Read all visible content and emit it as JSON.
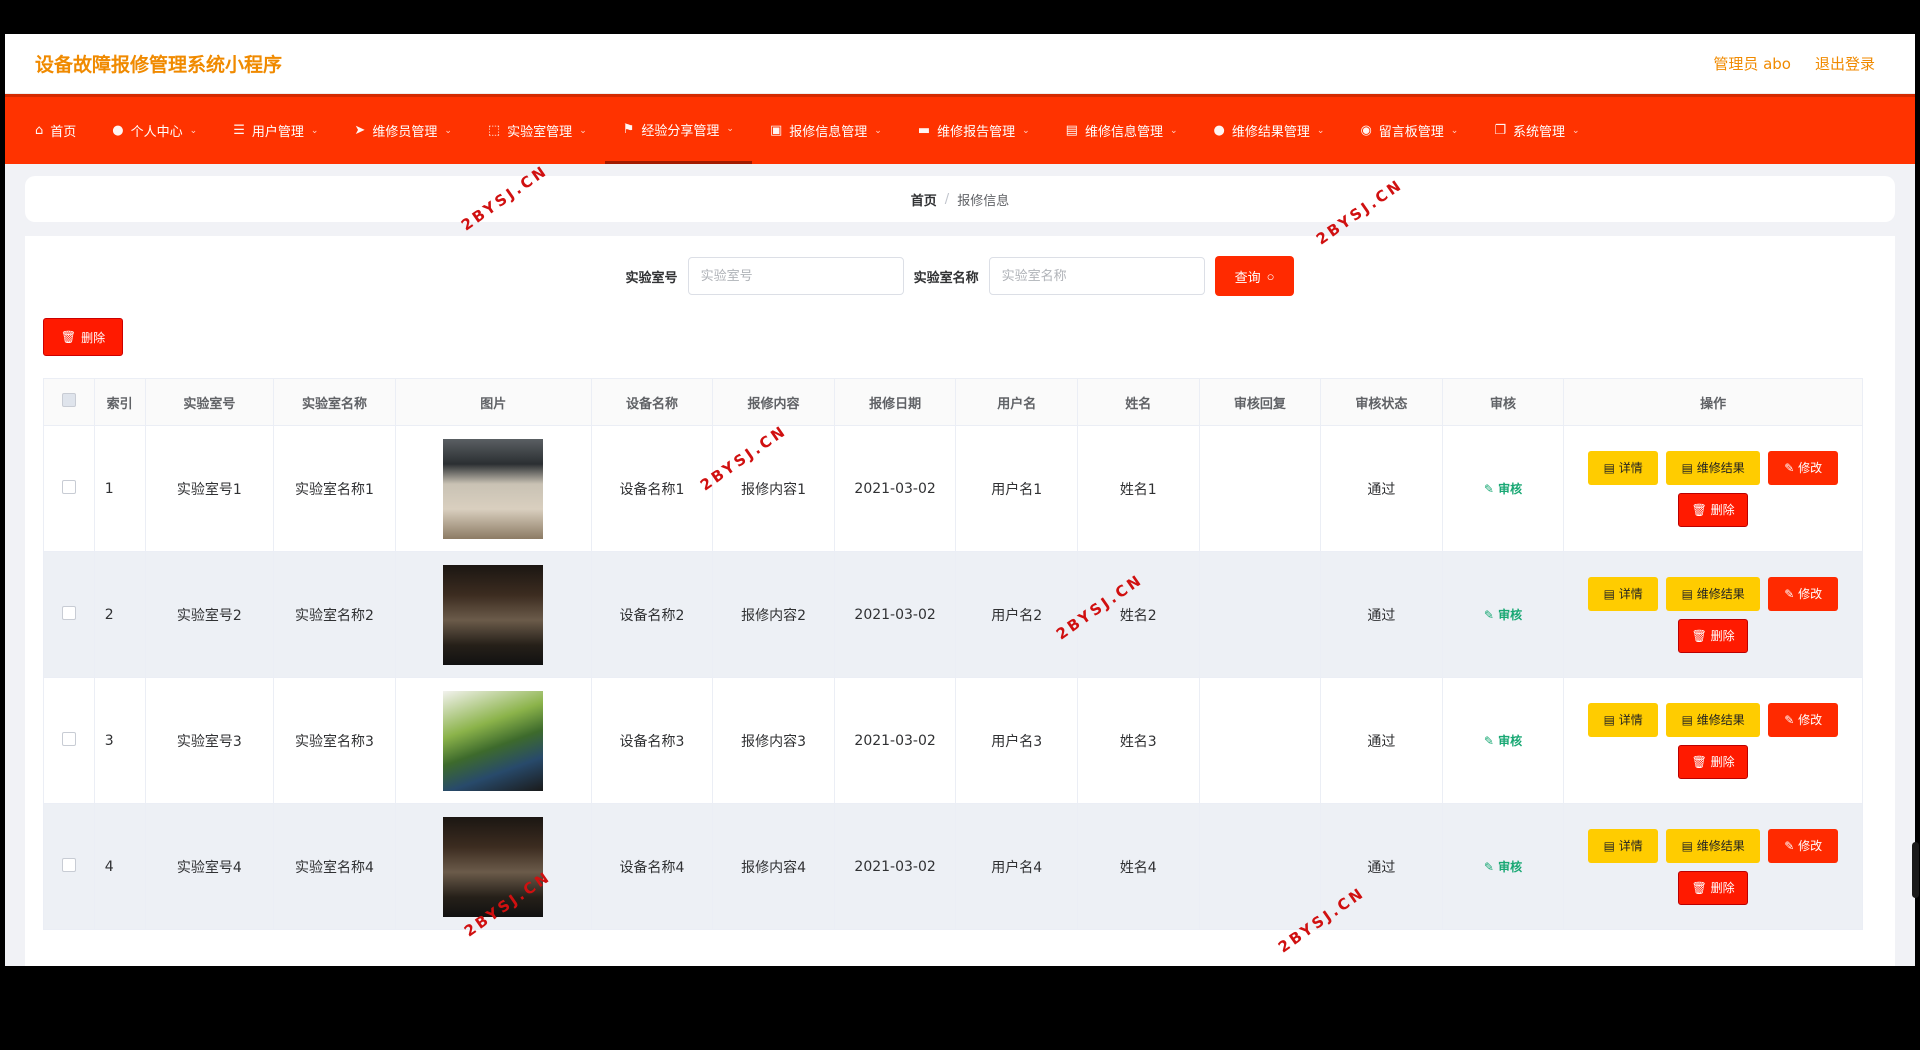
{
  "app": {
    "title": "设备故障报修管理系统小程序",
    "admin_label": "管理员 abo",
    "logout_label": "退出登录"
  },
  "nav": [
    {
      "label": "首页",
      "icon": "home-icon",
      "glyph": "⌂"
    },
    {
      "label": "个人中心",
      "icon": "user-icon",
      "glyph": "●"
    },
    {
      "label": "用户管理",
      "icon": "list-icon",
      "glyph": "☰"
    },
    {
      "label": "维修员管理",
      "icon": "send-icon",
      "glyph": "➤"
    },
    {
      "label": "实验室管理",
      "icon": "scan-icon",
      "glyph": "⬚"
    },
    {
      "label": "经验分享管理",
      "icon": "flag-icon",
      "glyph": "⚑"
    },
    {
      "label": "报修信息管理",
      "icon": "clipboard-icon",
      "glyph": "▣"
    },
    {
      "label": "维修报告管理",
      "icon": "video-icon",
      "glyph": "▬"
    },
    {
      "label": "维修信息管理",
      "icon": "document-icon",
      "glyph": "▤"
    },
    {
      "label": "维修结果管理",
      "icon": "user-icon",
      "glyph": "●"
    },
    {
      "label": "留言板管理",
      "icon": "mic-icon",
      "glyph": "◉"
    },
    {
      "label": "系统管理",
      "icon": "copy-icon",
      "glyph": "❐"
    }
  ],
  "breadcrumb": {
    "home": "首页",
    "separator": "/",
    "current": "报修信息"
  },
  "search": {
    "field1_label": "实验室号",
    "field1_placeholder": "实验室号",
    "field2_label": "实验室名称",
    "field2_placeholder": "实验室名称",
    "query_label": "查询"
  },
  "delete_label": "删除",
  "table": {
    "headers": [
      "索引",
      "实验室号",
      "实验室名称",
      "图片",
      "设备名称",
      "报修内容",
      "报修日期",
      "用户名",
      "姓名",
      "审核回复",
      "审核状态",
      "审核",
      "操作"
    ],
    "rows": [
      {
        "index": "1",
        "lab_no": "实验室号1",
        "lab_name": "实验室名称1",
        "device": "设备名称1",
        "content": "报修内容1",
        "date": "2021-03-02",
        "username": "用户名1",
        "name": "姓名1",
        "reply": "",
        "status": "通过"
      },
      {
        "index": "2",
        "lab_no": "实验室号2",
        "lab_name": "实验室名称2",
        "device": "设备名称2",
        "content": "报修内容2",
        "date": "2021-03-02",
        "username": "用户名2",
        "name": "姓名2",
        "reply": "",
        "status": "通过"
      },
      {
        "index": "3",
        "lab_no": "实验室号3",
        "lab_name": "实验室名称3",
        "device": "设备名称3",
        "content": "报修内容3",
        "date": "2021-03-02",
        "username": "用户名3",
        "name": "姓名3",
        "reply": "",
        "status": "通过"
      },
      {
        "index": "4",
        "lab_no": "实验室号4",
        "lab_name": "实验室名称4",
        "device": "设备名称4",
        "content": "报修内容4",
        "date": "2021-03-02",
        "username": "用户名4",
        "name": "姓名4",
        "reply": "",
        "status": "通过"
      }
    ],
    "actions": {
      "audit": "审核",
      "detail": "详情",
      "result": "维修结果",
      "edit": "修改",
      "delete": "删除"
    }
  },
  "watermark_text": "2BYSJ.CN",
  "colors": {
    "nav_bg": "#ff3300",
    "title": "#f08a00",
    "warning": "#ffcc00",
    "danger": "#ff2a00",
    "audit": "#19a874"
  }
}
